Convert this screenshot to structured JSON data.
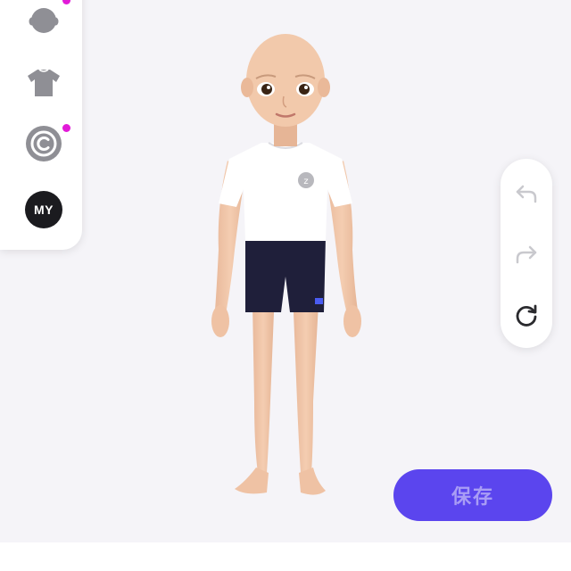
{
  "categories": [
    {
      "name": "head",
      "icon": "head-icon",
      "has_dot": true
    },
    {
      "name": "clothing",
      "icon": "tshirt-icon",
      "has_dot": false
    },
    {
      "name": "brand",
      "icon": "copyright-icon",
      "has_dot": true
    },
    {
      "name": "mine",
      "label": "MY",
      "has_dot": false
    }
  ],
  "history": {
    "undo_icon": "undo-icon",
    "redo_icon": "redo-icon",
    "reset_icon": "reset-icon"
  },
  "save_button": {
    "label": "保存"
  },
  "colors": {
    "accent": "#5b45ee",
    "notification_dot": "#e21ad8",
    "background": "#f5f4f8",
    "icon_gray": "#8f8f95"
  }
}
